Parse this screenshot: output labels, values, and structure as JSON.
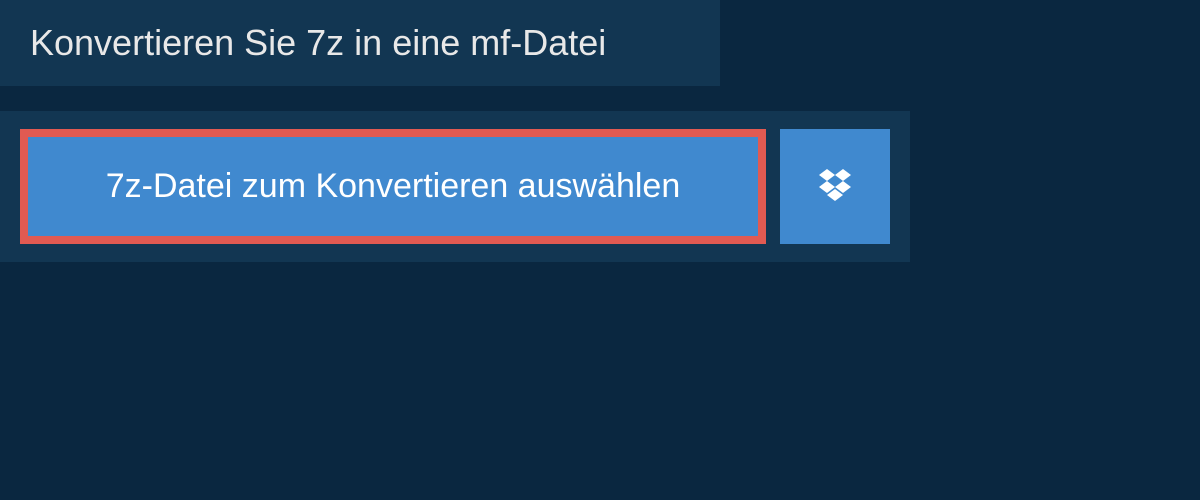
{
  "header": {
    "title": "Konvertieren Sie 7z in eine mf-Datei"
  },
  "upload": {
    "select_button_label": "7z-Datei zum Konvertieren auswählen"
  },
  "colors": {
    "page_background": "#0a2740",
    "panel_background": "#123652",
    "button_background": "#4089cf",
    "highlight_border": "#e15a52",
    "text_light": "#e8e8e8"
  }
}
